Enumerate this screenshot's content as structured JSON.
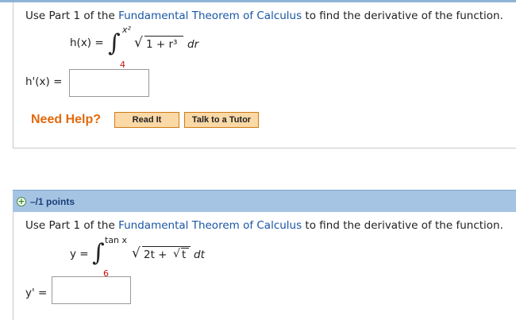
{
  "question1": {
    "prompt_before": "Use Part 1 of the ",
    "prompt_link": "Fundamental Theorem of Calculus",
    "prompt_after": " to find the derivative of the function.",
    "lhs": "h(x) =",
    "upper_limit": "x²",
    "lower_limit": "4",
    "integrand_under_root": "1 + r³",
    "integrand_var": "dr",
    "answer_label": "h'(x) =",
    "answer_value": ""
  },
  "help": {
    "need_help": "Need Help?",
    "read_it": "Read It",
    "talk_to_tutor": "Talk to a Tutor"
  },
  "question2": {
    "points_label": "–/1 points",
    "prompt_before": "Use Part 1 of the ",
    "prompt_link": "Fundamental Theorem of Calculus",
    "prompt_after": " to find the derivative of the function.",
    "lhs": "y =",
    "upper_limit": "tan x",
    "lower_limit": "6",
    "integrand_a": "2t + ",
    "integrand_b": "t",
    "integrand_var": "dt",
    "answer_label": "y' =",
    "answer_value": ""
  },
  "colors": {
    "link": "#1a56a5",
    "help": "#e2690c",
    "points_bar": "#a5c4e3",
    "button_bg": "#fbd9a7"
  }
}
